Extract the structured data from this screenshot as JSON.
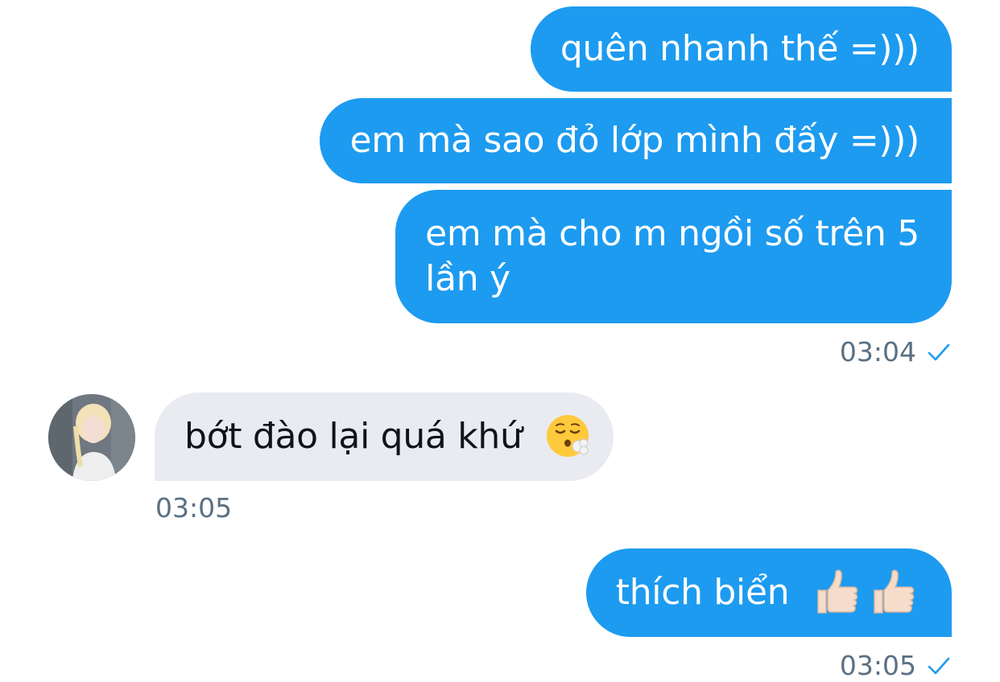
{
  "messages": [
    {
      "direction": "outgoing",
      "text": "quên nhanh thế =)))"
    },
    {
      "direction": "outgoing",
      "text": "em mà sao đỏ lớp mình đấy =)))"
    },
    {
      "direction": "outgoing",
      "lines": [
        "em mà cho m ngồi số trên 5",
        "lần ý"
      ],
      "time": "03:04",
      "status_icon": "sent-check-icon"
    },
    {
      "direction": "incoming",
      "text": "bớt đào lại quá khứ",
      "emoji": "face-exhaling-emoji",
      "time": "03:05"
    },
    {
      "direction": "outgoing",
      "text": "thích biển",
      "emoji": [
        "thumbs-up-emoji",
        "thumbs-up-emoji"
      ],
      "time": "03:05",
      "status_icon": "sent-check-icon"
    }
  ],
  "colors": {
    "outgoing_bubble": "#1d9bf0",
    "incoming_bubble": "#e9ebf1",
    "timestamp": "#5b7083",
    "check": "#1d9bf0"
  }
}
